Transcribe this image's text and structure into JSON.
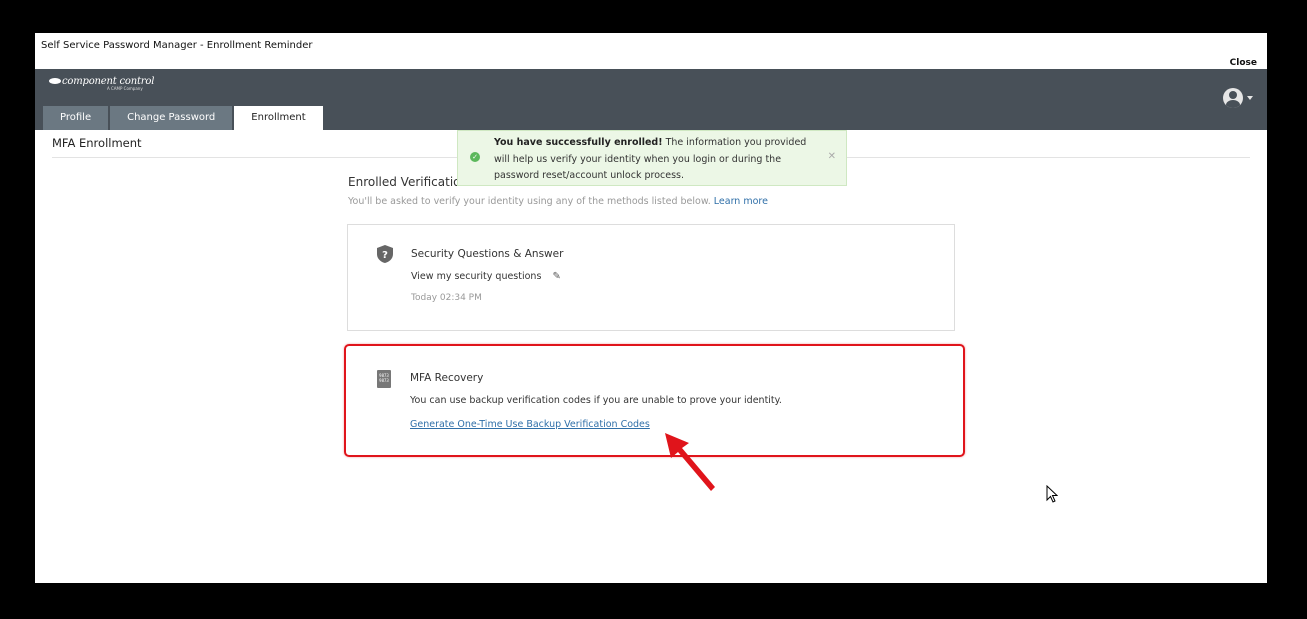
{
  "window": {
    "title": "Self Service Password Manager - Enrollment Reminder",
    "close_label": "Close"
  },
  "header": {
    "logo_text": "component control",
    "logo_sub": "A CAMP Company",
    "tabs": [
      {
        "label": "Profile",
        "active": false
      },
      {
        "label": "Change Password",
        "active": false
      },
      {
        "label": "Enrollment",
        "active": true
      }
    ],
    "user_icon": "user-circle-icon"
  },
  "page": {
    "title": "MFA Enrollment"
  },
  "toast": {
    "bold": "You have successfully enrolled!",
    "text": " The information you provided will help us verify your identity when you login or during the password reset/account unlock process.",
    "status_color": "#5cb85c"
  },
  "section": {
    "title": "Enrolled Verification Methods",
    "subtitle": "You'll be asked to verify your identity using any of the methods listed below.",
    "learn_more": "Learn more"
  },
  "methods": [
    {
      "icon": "shield-question-icon",
      "title": "Security Questions & Answer",
      "action": "View my security questions",
      "meta": "Today 02:34 PM"
    },
    {
      "icon": "backup-codes-icon",
      "title": "MFA Recovery",
      "description": "You can use backup verification codes if you are unable to prove your identity.",
      "link": "Generate One-Time Use Backup Verification Codes",
      "icon_text": "9873 9873"
    }
  ],
  "annotation": {
    "highlight_color": "#e0141b"
  }
}
